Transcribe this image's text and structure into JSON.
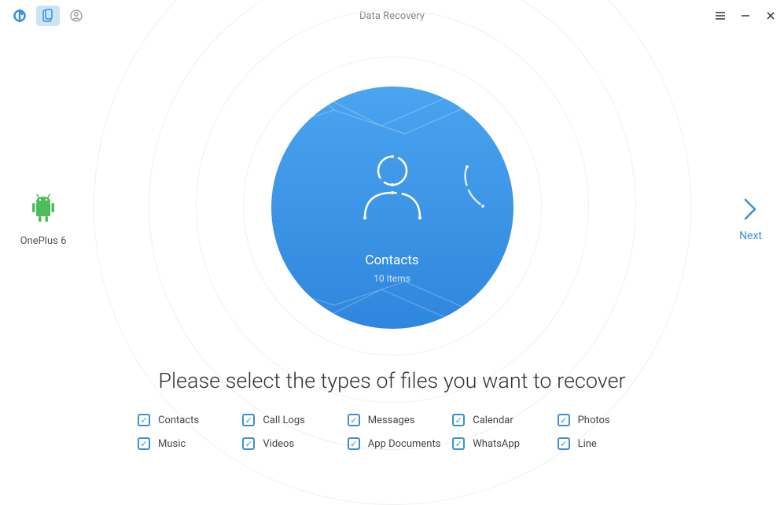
{
  "titlebar": {
    "title": "Data Recovery"
  },
  "device": {
    "name": "OnePlus 6"
  },
  "next": {
    "label": "Next"
  },
  "center": {
    "title": "Contacts",
    "subtitle": "10 Items"
  },
  "instruction": "Please select the types of files you want to recover",
  "fileTypes": [
    {
      "label": "Contacts",
      "checked": true
    },
    {
      "label": "Call Logs",
      "checked": true
    },
    {
      "label": "Messages",
      "checked": true
    },
    {
      "label": "Calendar",
      "checked": true
    },
    {
      "label": "Photos",
      "checked": true
    },
    {
      "label": "Music",
      "checked": true
    },
    {
      "label": "Videos",
      "checked": true
    },
    {
      "label": "App Documents",
      "checked": true
    },
    {
      "label": "WhatsApp",
      "checked": true
    },
    {
      "label": "Line",
      "checked": true
    }
  ]
}
